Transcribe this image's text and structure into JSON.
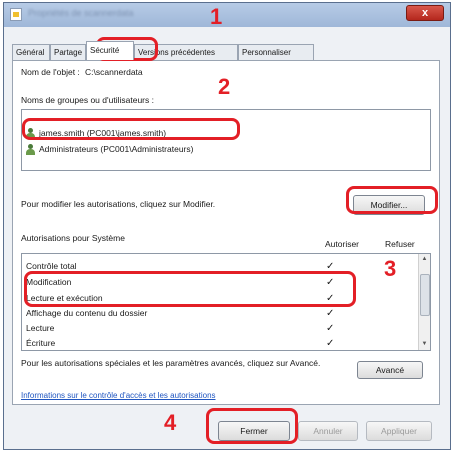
{
  "window": {
    "title": "Propriétés de scannerdata",
    "close_label": "x"
  },
  "tabs": [
    "Général",
    "Partage",
    "Sécurité",
    "Versions précédentes",
    "Personnaliser"
  ],
  "security": {
    "object_label": "Nom de l'objet :",
    "object_value": "C:\\scannerdata",
    "groups_label": "Noms de groupes ou d'utilisateurs :",
    "users": [
      "james.smith (PC001\\james.smith)",
      "Administrateurs (PC001\\Administrateurs)"
    ],
    "modify_hint": "Pour modifier les autorisations, cliquez sur Modifier.",
    "modify_button": "Modifier...",
    "perms_label": "Autorisations pour Système",
    "allow_header": "Autoriser",
    "deny_header": "Refuser",
    "permissions": [
      {
        "name": "Contrôle total",
        "allow": "✓"
      },
      {
        "name": "Modification",
        "allow": "✓"
      },
      {
        "name": "Lecture et exécution",
        "allow": "✓"
      },
      {
        "name": "Affichage du contenu du dossier",
        "allow": "✓"
      },
      {
        "name": "Lecture",
        "allow": "✓"
      },
      {
        "name": "Écriture",
        "allow": "✓"
      }
    ],
    "advanced_text": "Pour les autorisations spéciales et les paramètres avancés, cliquez sur Avancé.",
    "advanced_button": "Avancé",
    "link_text": "Informations sur le contrôle d'accès et les autorisations"
  },
  "footer": {
    "close_button": "Fermer",
    "cancel_button": "Annuler",
    "apply_button": "Appliquer"
  },
  "callouts": [
    "1",
    "2",
    "3",
    "4"
  ],
  "colors": {
    "highlight": "#e31f26",
    "link": "#1f55c0"
  }
}
